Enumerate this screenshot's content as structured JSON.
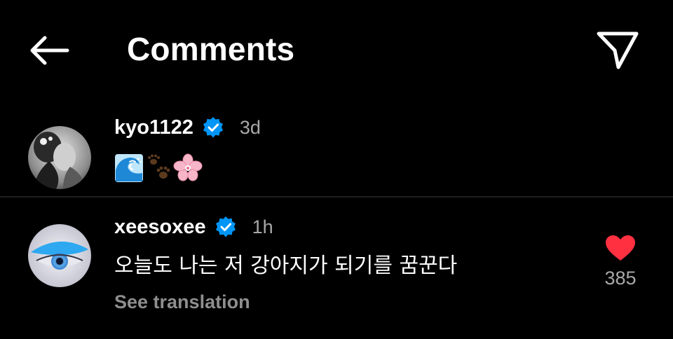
{
  "header": {
    "title": "Comments",
    "back_icon": "arrow-left-icon",
    "share_icon": "paper-plane-icon"
  },
  "comments": [
    {
      "username": "kyo1122",
      "verified": true,
      "time": "3d",
      "text": "🌊🐾🌸",
      "emojis": [
        "water-wave-emoji",
        "paw-prints-emoji",
        "cherry-blossom-emoji"
      ]
    },
    {
      "username": "xeesoxee",
      "verified": true,
      "time": "1h",
      "text": "오늘도 나는 저 강아지가 되기를 꿈꾼다",
      "see_translation": "See translation",
      "liked": true,
      "like_count": "385"
    }
  ],
  "colors": {
    "background": "#000000",
    "text": "#ffffff",
    "muted": "#a8a8a8",
    "verified_blue": "#0095f6",
    "like_red": "#ff3040"
  }
}
